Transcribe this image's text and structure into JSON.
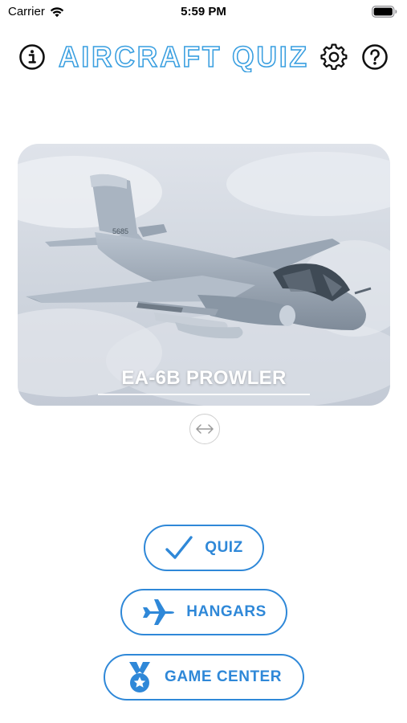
{
  "status_bar": {
    "carrier": "Carrier",
    "time": "5:59 PM"
  },
  "header": {
    "title": "AIRCRAFT QUIZ",
    "icons": [
      "info-icon",
      "gear-icon",
      "help-icon"
    ]
  },
  "featured": {
    "aircraft_name": "EA-6B PROWLER"
  },
  "menu": {
    "quiz_label": "QUIZ",
    "hangars_label": "HANGARS",
    "game_center_label": "GAME CENTER"
  },
  "colors": {
    "accent": "#2f88d8",
    "title": "#3a9fe0"
  }
}
